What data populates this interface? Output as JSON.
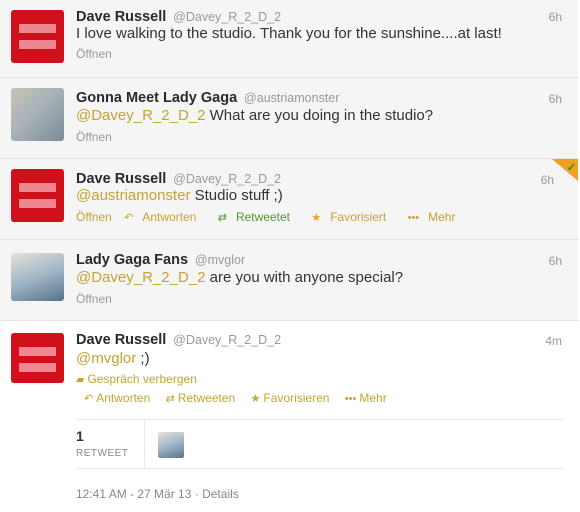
{
  "tweets": [
    {
      "name": "Dave Russell",
      "handle": "@Davey_R_2_D_2",
      "time": "6h",
      "text": "I love walking to the studio. Thank you for the sunshine....at last!",
      "expand": "Öffnen",
      "avatar_icon": "equality-logo"
    },
    {
      "name": "Gonna Meet Lady Gaga",
      "handle": "@austriamonster",
      "time": "6h",
      "mention": "@Davey_R_2_D_2",
      "text": " What are you doing in the studio?",
      "expand": "Öffnen",
      "avatar_icon": "user-photo"
    },
    {
      "name": "Dave Russell",
      "handle": "@Davey_R_2_D_2",
      "time": "6h",
      "mention": "@austriamonster",
      "text": " Studio stuff ;)",
      "actions": {
        "open": "Öffnen",
        "reply": "Antworten",
        "retweeted": "Retweetet",
        "favorited": "Favorisiert",
        "more": "Mehr"
      },
      "avatar_icon": "equality-logo"
    },
    {
      "name": "Lady Gaga Fans",
      "handle": "@mvglor",
      "time": "6h",
      "mention": "@Davey_R_2_D_2",
      "text": " are you with anyone special?",
      "expand": "Öffnen",
      "avatar_icon": "user-photo"
    }
  ],
  "open_tweet": {
    "name": "Dave Russell",
    "handle": "@Davey_R_2_D_2",
    "time": "4m",
    "mention": "@mvglor",
    "text": " ;)",
    "hide_conversation": "Gespräch verbergen",
    "actions": {
      "reply": "Antworten",
      "retweet": "Retweeten",
      "favorite": "Favorisieren",
      "more": "Mehr"
    },
    "retweet_count": "1",
    "retweet_label": "RETWEET",
    "timestamp": "12:41 AM - 27 Mär 13",
    "separator": "·",
    "details": "Details"
  },
  "colors": {
    "link": "#c5a432",
    "retweeted": "#4a9d2e",
    "avatar_red": "#d0101a",
    "avatar_bars": "#ee8890"
  }
}
